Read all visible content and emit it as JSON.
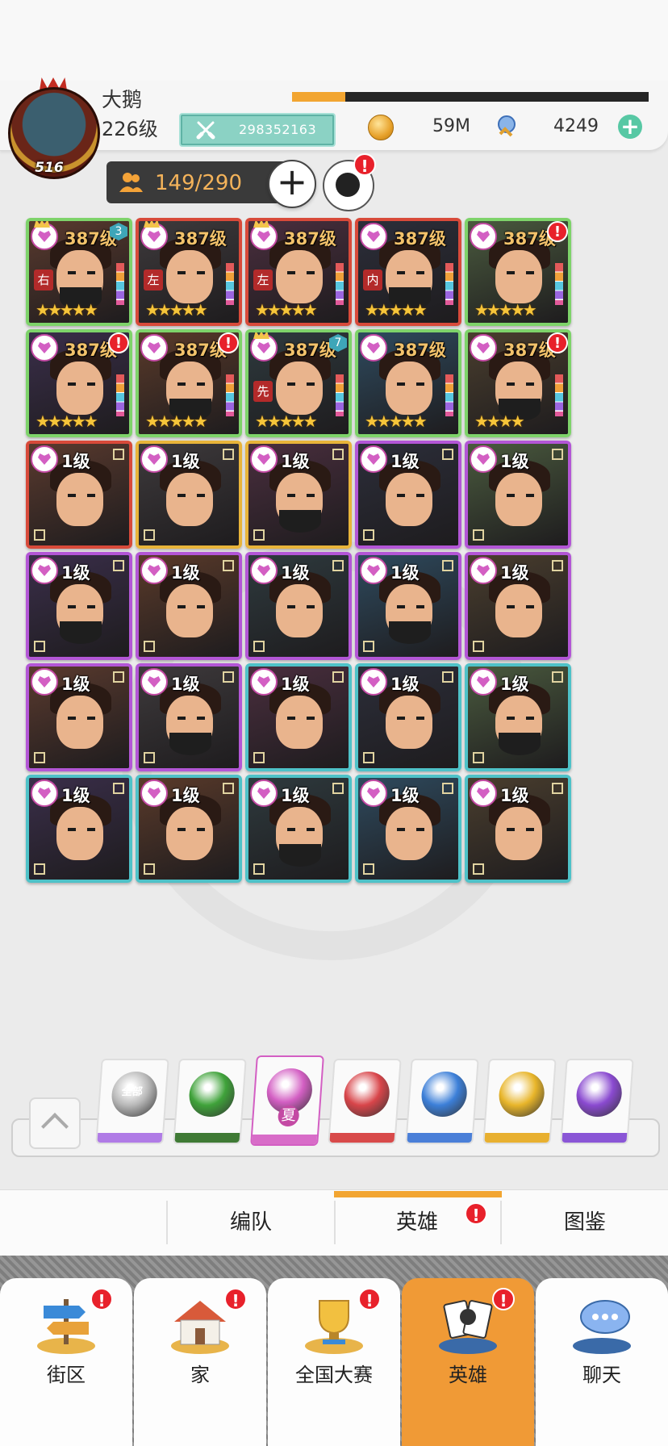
{
  "player": {
    "name": "大鹅",
    "level": "226级",
    "avatar_level": "516",
    "xp_fraction": 0.15,
    "power": "298352163"
  },
  "resources": {
    "coins": "59M",
    "gems": "4249",
    "add": "+"
  },
  "roster": {
    "capacity": "149/290",
    "add": "+",
    "helper_badge": "!"
  },
  "heroes": [
    {
      "level": "387级",
      "frame": "green",
      "tag": "右",
      "stars": "★★★★★",
      "badge": "3",
      "crown": true
    },
    {
      "level": "387级",
      "frame": "red",
      "tag": "左",
      "stars": "★★★★★",
      "crown": true
    },
    {
      "level": "387级",
      "frame": "red",
      "tag": "左",
      "stars": "★★★★★",
      "crown": true
    },
    {
      "level": "387级",
      "frame": "red",
      "tag": "内",
      "stars": "★★★★★"
    },
    {
      "level": "387级",
      "frame": "green",
      "stars": "★★★★★",
      "alert": "!"
    },
    {
      "level": "387级",
      "frame": "green",
      "stars": "★★★★★",
      "alert": "!"
    },
    {
      "level": "387级",
      "frame": "green",
      "stars": "★★★★★",
      "alert": "!"
    },
    {
      "level": "387级",
      "frame": "green",
      "tag": "先",
      "stars": "★★★★★",
      "badge": "7",
      "crown": true
    },
    {
      "level": "387级",
      "frame": "green",
      "stars": "★★★★★"
    },
    {
      "level": "387级",
      "frame": "green",
      "stars": "★★★★",
      "alert": "!"
    },
    {
      "level": "1级",
      "frame": "red"
    },
    {
      "level": "1级",
      "frame": "gold"
    },
    {
      "level": "1级",
      "frame": "gold"
    },
    {
      "level": "1级",
      "frame": "purple"
    },
    {
      "level": "1级",
      "frame": "purple"
    },
    {
      "level": "1级",
      "frame": "purple"
    },
    {
      "level": "1级",
      "frame": "purple"
    },
    {
      "level": "1级",
      "frame": "purple"
    },
    {
      "level": "1级",
      "frame": "purple"
    },
    {
      "level": "1级",
      "frame": "purple"
    },
    {
      "level": "1级",
      "frame": "purple"
    },
    {
      "level": "1级",
      "frame": "purple"
    },
    {
      "level": "1级",
      "frame": "teal"
    },
    {
      "level": "1级",
      "frame": "teal"
    },
    {
      "level": "1级",
      "frame": "teal"
    },
    {
      "level": "1级",
      "frame": "teal"
    },
    {
      "level": "1级",
      "frame": "teal"
    },
    {
      "level": "1级",
      "frame": "teal"
    },
    {
      "level": "1级",
      "frame": "teal"
    },
    {
      "level": "1级",
      "frame": "teal"
    }
  ],
  "factions": [
    {
      "name": "all",
      "label": "全部",
      "color": "#b9b9b9",
      "bar": "#b07be6"
    },
    {
      "name": "green",
      "color": "#3fa23a",
      "bar": "#3f7a35"
    },
    {
      "name": "pink",
      "label": "夏",
      "color": "#d35fc3",
      "bar": "#d86cc8",
      "selected": true
    },
    {
      "name": "red",
      "color": "#d8454a",
      "bar": "#d84a4a"
    },
    {
      "name": "blue",
      "color": "#3c7fd8",
      "bar": "#4a7fd8"
    },
    {
      "name": "gold",
      "color": "#e8b52a",
      "bar": "#e8b030"
    },
    {
      "name": "violet",
      "color": "#8a4ad0",
      "bar": "#8a56d6"
    }
  ],
  "subtabs": [
    {
      "label": "编队"
    },
    {
      "label": "英雄",
      "badge": "!"
    },
    {
      "label": "图鉴"
    }
  ],
  "nav": [
    {
      "label": "街区",
      "icon": "signpost-icon",
      "badge": "!"
    },
    {
      "label": "家",
      "icon": "house-icon",
      "badge": "!"
    },
    {
      "label": "全国大赛",
      "icon": "trophy-icon",
      "badge": "!"
    },
    {
      "label": "英雄",
      "icon": "hero-cards-icon",
      "badge": "!",
      "active": true
    },
    {
      "label": "聊天",
      "icon": "chat-bubbles-icon"
    }
  ],
  "colors": {
    "accent": "#f2a531",
    "power_bg": "#8bd2c4",
    "alert": "#e8212b"
  }
}
